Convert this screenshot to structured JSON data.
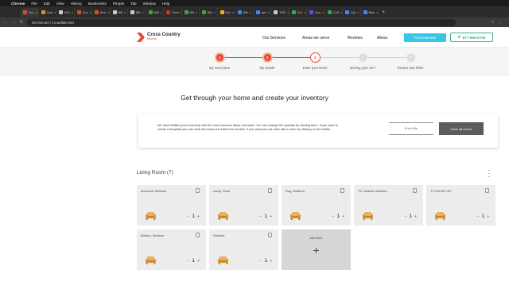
{
  "os_menu": {
    "app": "Chrome",
    "items": [
      "File",
      "Edit",
      "View",
      "History",
      "Bookmarks",
      "People",
      "Tab",
      "Window",
      "Help"
    ]
  },
  "browser": {
    "tabs": [
      {
        "label": "Cro",
        "color": "#e64a2e"
      },
      {
        "label": "How",
        "color": "#e88a2e"
      },
      {
        "label": "WO",
        "color": "#cccccc"
      },
      {
        "label": "Cho",
        "color": "#e64a2e"
      },
      {
        "label": "Mov",
        "color": "#e64a2e"
      },
      {
        "label": "Bill",
        "color": "#cccccc"
      },
      {
        "label": "Bill",
        "color": "#cccccc"
      },
      {
        "label": "Mill",
        "color": "#2eaa4a"
      },
      {
        "label": "Crea",
        "color": "#d93025"
      },
      {
        "label": "Bill",
        "color": "#2eaa4a"
      },
      {
        "label": "Bill",
        "color": "#2eaa4a"
      },
      {
        "label": "Dre",
        "color": "#f4b400"
      },
      {
        "label": "Bill",
        "color": "#4285f4"
      },
      {
        "label": "syn",
        "color": "#4285f4"
      },
      {
        "label": "TUR",
        "color": "#cccccc"
      },
      {
        "label": "Crit",
        "color": "#2eaa4a"
      },
      {
        "label": "Cus",
        "color": "#7b3fe4"
      },
      {
        "label": "CaS",
        "color": "#2eaa4a"
      },
      {
        "label": "Gal",
        "color": "#4285f4"
      },
      {
        "label": "Bulk",
        "color": "#4285f4"
      }
    ],
    "url": "Not Secure | cx.walldev.net"
  },
  "header": {
    "logo_title": "Cross Country",
    "logo_subtitle": "Movers",
    "nav": [
      "Our Services",
      "Areas we serve",
      "Reviews",
      "About"
    ],
    "quote_button": "Free estimate",
    "phone": "877-666-0708"
  },
  "stepper": {
    "steps": [
      {
        "num": "1",
        "label": "My move plan",
        "state": "done"
      },
      {
        "num": "2",
        "label": "My details",
        "state": "done"
      },
      {
        "num": "3",
        "label": "Enter your items",
        "state": "current"
      },
      {
        "num": "4",
        "label": "Moving your car?",
        "state": "todo"
      },
      {
        "num": "5",
        "label": "Review and finish",
        "state": "todo"
      }
    ]
  },
  "page": {
    "title": "Get through your home and create your inventory"
  },
  "info": {
    "text": "We have drafted your inventory with the most common items and sizes. You can change the quantity by clicking them. If you want to create a template you can clear all rooms and start from scratch. If you want you can also add a room by clicking on the button.",
    "input_placeholder": "Enter title",
    "clear_button": "Clear all rooms"
  },
  "room": {
    "title": "Living Room (7)",
    "menu_icon": "kebab-menu-icon",
    "items": [
      {
        "name": "Armchair, Medium",
        "qty": "1"
      },
      {
        "name": "Lamp, Floor",
        "qty": "1"
      },
      {
        "name": "Rug, Medium",
        "qty": "1"
      },
      {
        "name": "TV Cabinet, Medium",
        "qty": "1"
      },
      {
        "name": "TV Flat 40\"-50\"",
        "qty": "1"
      },
      {
        "name": "Bottom, Medium",
        "qty": "1"
      },
      {
        "name": "Window",
        "qty": "1"
      }
    ],
    "add_label": "Add Item",
    "add_symbol": "+",
    "minus_symbol": "−",
    "plus_symbol": "+"
  },
  "colors": {
    "brand_red": "#e64a2e",
    "accent_cyan": "#35c6e8",
    "phone_green": "#36b37e",
    "sofa": "#e6b35c"
  }
}
